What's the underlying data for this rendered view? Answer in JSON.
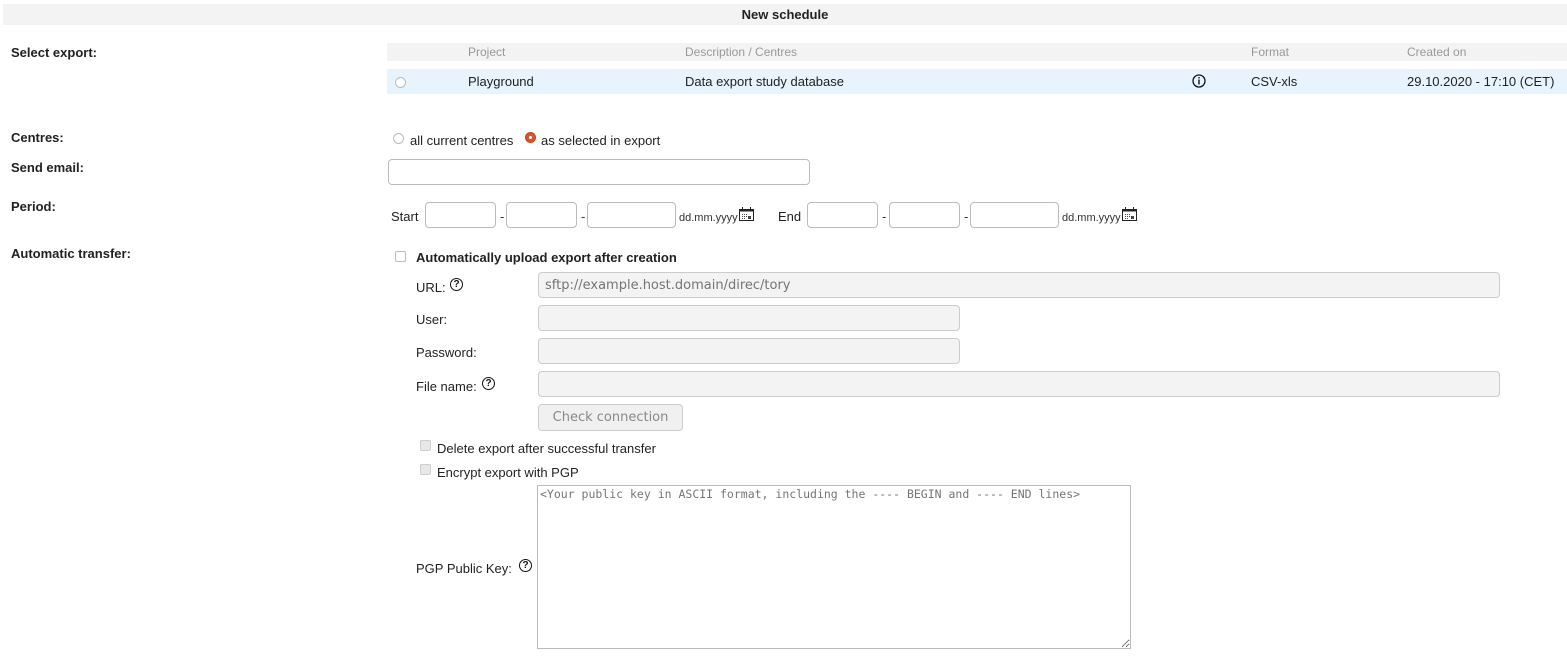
{
  "header": {
    "title": "New schedule"
  },
  "labels": {
    "select_export": "Select export:",
    "centres": "Centres:",
    "send_email": "Send email:",
    "period": "Period:",
    "automatic_transfer": "Automatic transfer:"
  },
  "export_table": {
    "columns": [
      "Project",
      "Description / Centres",
      "Format",
      "Created on"
    ],
    "rows": [
      {
        "project": "Playground",
        "description": "Data export study database",
        "info_icon": "info-icon",
        "format": "CSV-xls",
        "created_on": "29.10.2020 - 17:10 (CET)",
        "selected": false
      }
    ]
  },
  "centres": {
    "options": [
      {
        "label": "all current centres",
        "checked": false
      },
      {
        "label": "as selected in export",
        "checked": true
      }
    ]
  },
  "send_email": {
    "value": ""
  },
  "period": {
    "start_label": "Start",
    "end_label": "End",
    "separator": "-",
    "format_hint": "dd.mm.yyyy",
    "calendar_icon": "calendar-icon",
    "start": {
      "day": "",
      "month": "",
      "year": ""
    },
    "end": {
      "day": "",
      "month": "",
      "year": ""
    }
  },
  "transfer": {
    "auto_upload_label": "Automatically upload export after creation",
    "auto_upload_checked": false,
    "url_label": "URL:",
    "url_placeholder": "sftp://example.host.domain/direc/tory",
    "user_label": "User:",
    "password_label": "Password:",
    "file_name_label": "File name:",
    "check_connection_label": "Check connection",
    "delete_after_label": "Delete export after successful transfer",
    "encrypt_label": "Encrypt export with PGP",
    "pgp_key_label": "PGP Public Key:",
    "pgp_key_placeholder": "<Your public key in ASCII format, including the ---- BEGIN and ---- END lines>",
    "help_glyph": "?"
  },
  "colors": {
    "accent_radio": "#d2572c",
    "row_highlight": "#e8f4fd",
    "header_bg": "#f3f3f3"
  }
}
